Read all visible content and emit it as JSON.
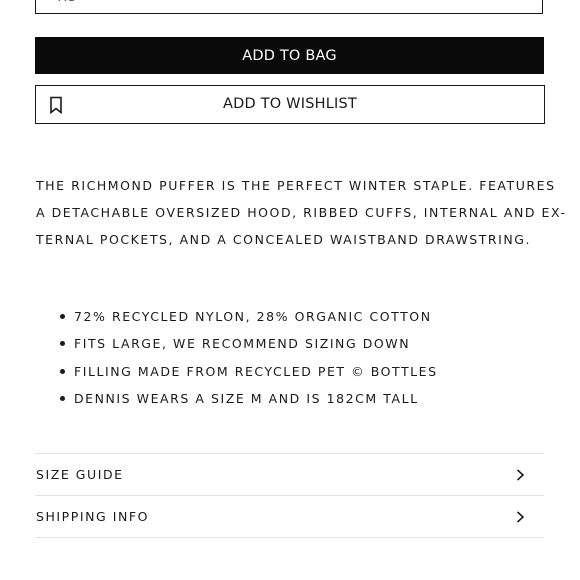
{
  "size_select": {
    "value": "XS",
    "icon": "chevron-down-icon"
  },
  "add_to_bag": {
    "label": "ADD TO BAG"
  },
  "add_to_wishlist": {
    "label": "ADD TO WISHLIST",
    "icon": "bookmark-icon"
  },
  "description": {
    "lines": [
      "THE RICHMOND PUFFER IS THE PERFECT WINTER STAPLE. FEATURES",
      "A DETACHABLE OVERSIZED HOOD, RIBBED CUFFS, INTERNAL AND EX-",
      "TERNAL POCKETS, AND A CONCEALED WAISTBAND DRAWSTRING."
    ]
  },
  "features": [
    "72% RECYCLED NYLON, 28% ORGANIC COTTON",
    "FITS LARGE, WE RECOMMEND SIZING DOWN",
    "FILLING MADE FROM RECYCLED PET © BOTTLES",
    "DENNIS WEARS A SIZE M AND IS 182CM TALL"
  ],
  "accordion": [
    {
      "label": "SIZE GUIDE",
      "icon": "chevron-right-icon"
    },
    {
      "label": "SHIPPING INFO",
      "icon": "chevron-right-icon"
    }
  ],
  "colors": {
    "primary": "#0a0a0a",
    "background": "#ffffff",
    "divider": "#e2e2e2"
  }
}
